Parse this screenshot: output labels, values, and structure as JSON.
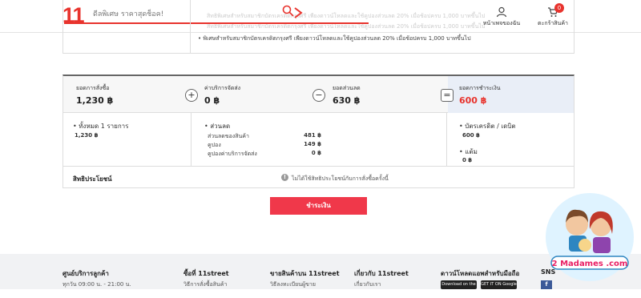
{
  "header": {
    "logo": "11",
    "search_placeholder": "ดีลพิเศษ ราคาสุดช็อค!",
    "behind_text_1": "สิทธิพิเศษสำหรับสมาชิกบัตรเครดิตกรุงศรี เพียงดาวน์โหลดและใช้คูปองส่วนลด 20% เมื่อช้อปครบ 1,000 บาทขึ้นไป",
    "behind_text_2": "สิทธิพิเศษสำหรับสมาชิกบัตรเครดิตกรุงศรี เพียงดาวน์โหลดและใช้คูปองส่วนลด 20% เมื่อช้อปครบ 1,000 บาทขึ้นไป",
    "my_page": "หน้าเพจของฉัน",
    "cart": "ตะกร้าสินค้า",
    "cart_count": "0"
  },
  "notice": "• พิเศษสำหรับสมาชิกบัตรเครดิตกรุงศรี เพียงดาวน์โหลดและใช้คูปองส่วนลด 20% เมื่อช้อปครบ 1,000 บาทขึ้นไป",
  "summary": {
    "order_total_label": "ยอดการสั่งซื้อ",
    "order_total_value": "1,230 ฿",
    "shipping_label": "ค่าบริการจัดส่ง",
    "shipping_value": "0 ฿",
    "discount_label": "ยอดส่วนลด",
    "discount_value": "630 ฿",
    "payment_label": "ยอดการชำระเงิน",
    "payment_value": "600 ฿",
    "op_plus": "+",
    "op_minus": "−",
    "op_equals": "="
  },
  "details": {
    "items_title": "• ทั้งหมด 1 รายการ",
    "items_value": "1,230 ฿",
    "discount_title": "• ส่วนลด",
    "discount_rows": [
      {
        "label": "ส่วนลดของสินค้า",
        "value": "481 ฿"
      },
      {
        "label": "คูปอง",
        "value": "149 ฿"
      },
      {
        "label": "คูปองค่าบริการจัดส่ง",
        "value": "0 ฿"
      }
    ],
    "card_title": "• บัตรเครดิต / เดบิต",
    "card_value": "600 ฿",
    "points_title": "• แต้ม",
    "points_value": "0 ฿"
  },
  "benefit": {
    "title": "สิทธิประโยชน์",
    "info": "!",
    "text": "ไม่ได้ใช้สิทธิประโยชน์กับการสั่งซื้อครั้งนี้"
  },
  "pay_button": "ชำระเงิน",
  "footer": {
    "service_title": "ศูนย์บริการลูกค้า",
    "service_sub": "ทุกวัน 09:00 น. - 21:00 น.",
    "buy_title": "ซื้อที่ 11street",
    "buy_sub": "วิธีการสั่งซื้อสินค้า",
    "sell_title": "ขายสินค้าบน 11street",
    "sell_sub": "วิธีลงทะเบียนผู้ขาย",
    "about_title": "เกี่ยวกับ 11street",
    "about_sub": "เกี่ยวกับเรา",
    "app_title": "ดาวน์โหลดแอพสำหรับมือถือ",
    "store1": "Download on the App Store",
    "store2": "GET IT ON Google Play",
    "sns_title": "SNS",
    "fb": "f"
  },
  "watermark": "2 Madames .com",
  "colors": {
    "accent": "#e8332d",
    "pay_button": "#f0384a",
    "final_bg": "#e9eef7"
  }
}
